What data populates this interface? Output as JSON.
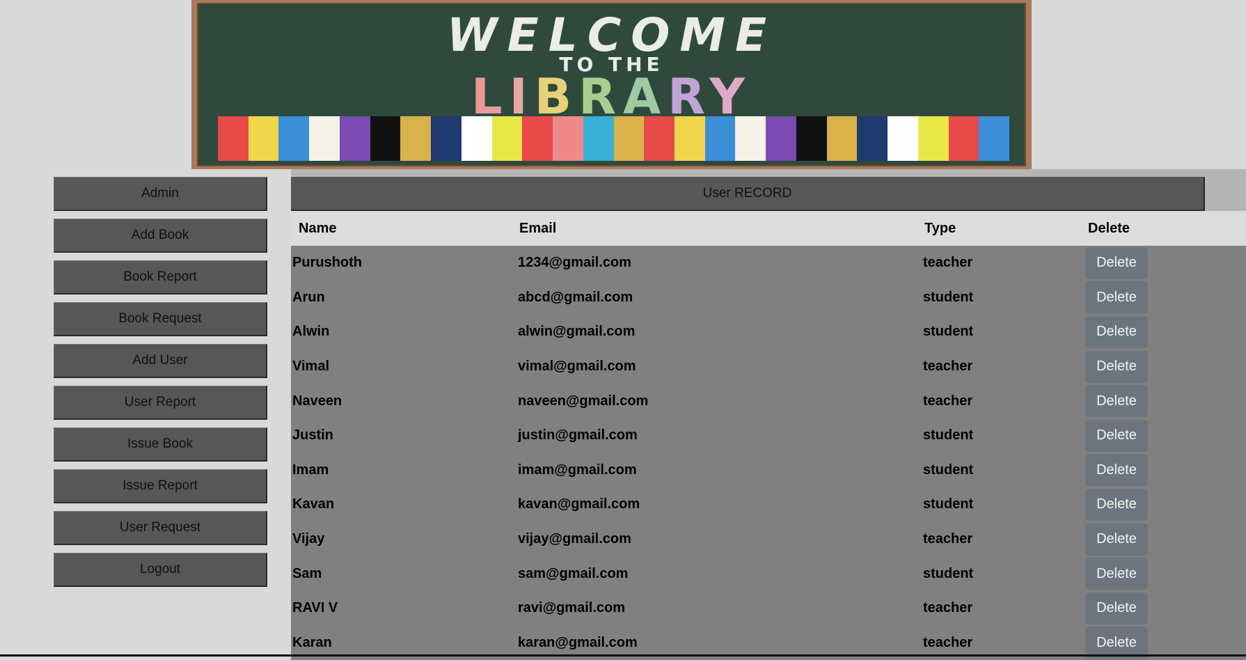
{
  "banner": {
    "welcome": "WELCOME",
    "to_the": "TO THE",
    "library_letters": [
      "L",
      "I",
      "B",
      "R",
      "A",
      "R",
      "Y"
    ],
    "book_colors": [
      "#e84a4a",
      "#f0d64a",
      "#3a8fd6",
      "#f2f2e8",
      "#7a4bb0",
      "#111111",
      "#d9b24a",
      "#1e3a6e",
      "#ffffff",
      "#e8e84a",
      "#e84a4a",
      "#f08a8a",
      "#3ab0d6",
      "#d9b24a",
      "#e84a4a",
      "#f0d64a",
      "#3a8fd6",
      "#f2f2e8",
      "#7a4bb0",
      "#111111",
      "#d9b24a",
      "#1e3a6e",
      "#ffffff",
      "#e8e84a",
      "#e84a4a",
      "#3a8fd6"
    ]
  },
  "sidebar": {
    "items": [
      {
        "label": "Admin"
      },
      {
        "label": "Add Book"
      },
      {
        "label": "Book Report"
      },
      {
        "label": "Book Request"
      },
      {
        "label": "Add User"
      },
      {
        "label": "User Report"
      },
      {
        "label": "Issue Book"
      },
      {
        "label": "Issue Report"
      },
      {
        "label": "User Request"
      },
      {
        "label": "Logout"
      }
    ]
  },
  "main": {
    "title": "User RECORD",
    "columns": {
      "name": "Name",
      "email": "Email",
      "type": "Type",
      "delete": "Delete"
    },
    "delete_label": "Delete",
    "rows": [
      {
        "name": "Purushoth",
        "email": "1234@gmail.com",
        "type": "teacher"
      },
      {
        "name": "Arun",
        "email": "abcd@gmail.com",
        "type": "student"
      },
      {
        "name": "Alwin",
        "email": "alwin@gmail.com",
        "type": "student"
      },
      {
        "name": "Vimal",
        "email": "vimal@gmail.com",
        "type": "teacher"
      },
      {
        "name": "Naveen",
        "email": "naveen@gmail.com",
        "type": "teacher"
      },
      {
        "name": "Justin",
        "email": "justin@gmail.com",
        "type": "student"
      },
      {
        "name": "Imam",
        "email": "imam@gmail.com",
        "type": "student"
      },
      {
        "name": "Kavan",
        "email": "kavan@gmail.com",
        "type": "student"
      },
      {
        "name": "Vijay",
        "email": "vijay@gmail.com",
        "type": "teacher"
      },
      {
        "name": "Sam",
        "email": "sam@gmail.com",
        "type": "student"
      },
      {
        "name": "RAVI V",
        "email": "ravi@gmail.com",
        "type": "teacher"
      },
      {
        "name": "Karan",
        "email": "karan@gmail.com",
        "type": "teacher"
      }
    ]
  },
  "colors": {
    "page_bg": "#d9d9d9",
    "button_bg": "#575757",
    "table_row_bg": "#808080",
    "delete_button_bg": "#6c757d"
  }
}
